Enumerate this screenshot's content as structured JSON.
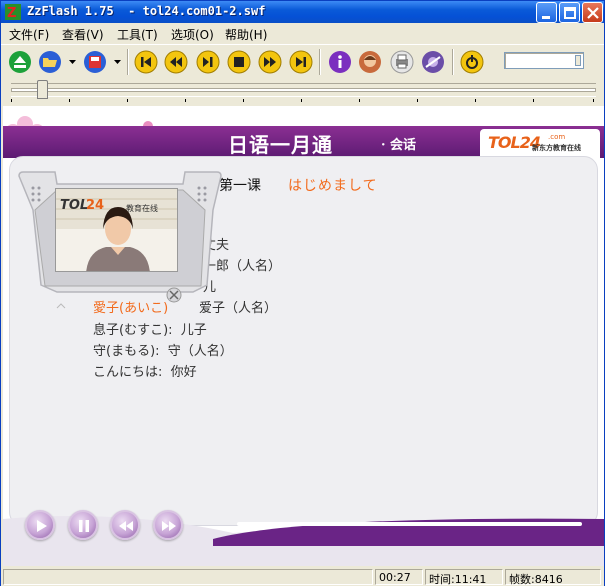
{
  "window": {
    "title": "ZzFlash 1.75  - tol24.com01-2.swf"
  },
  "menu": [
    {
      "label": "文件(F)"
    },
    {
      "label": "查看(V)"
    },
    {
      "label": "工具(T)"
    },
    {
      "label": "选项(O)"
    },
    {
      "label": "帮助(H)"
    }
  ],
  "toolbar": {
    "buttons": [
      "eject-icon",
      "open-folder-icon",
      "save-icon",
      "skip-start-icon",
      "rewind-icon",
      "pause-play-icon",
      "stop-icon",
      "forward-icon",
      "skip-end-icon",
      "info-icon",
      "avatar-icon",
      "print-icon",
      "settings-icon",
      "exit-icon"
    ]
  },
  "seek": {
    "progress_fraction": 0.05
  },
  "content": {
    "banner_title": "日语一月通",
    "banner_sub": "· 会话",
    "logo_text": "TOL",
    "logo_num": "24",
    "logo_com": ".com",
    "logo_cn": "新东方教育在线",
    "video_logo": "TOL24",
    "video_caption": "教育在线",
    "lesson_title": "第一课",
    "lesson_jp": "はじめまして",
    "vocab_partial": [
      {
        "text": "丈夫"
      },
      {
        "text": "一郎（人名）"
      },
      {
        "text": "儿"
      }
    ],
    "vocab_orange_partial": "愛子(あいこ)",
    "vocab_aiko": "爱子（人名）",
    "vocab": [
      {
        "text": "息子(むすこ):  儿子"
      },
      {
        "text": "守(まもる):  守（人名）"
      },
      {
        "text": "こんにちは:  你好"
      }
    ]
  },
  "controls": [
    "play-icon",
    "pause-icon",
    "rewind-icon",
    "fast-forward-icon"
  ],
  "status": {
    "empty": "",
    "elapsed": "00:27",
    "time": "时间:11:41",
    "frames": "帧数:8416"
  },
  "colors": {
    "accent": "#6a2486",
    "orange": "#f26b1d",
    "titlebar": "#0a5ad8"
  }
}
